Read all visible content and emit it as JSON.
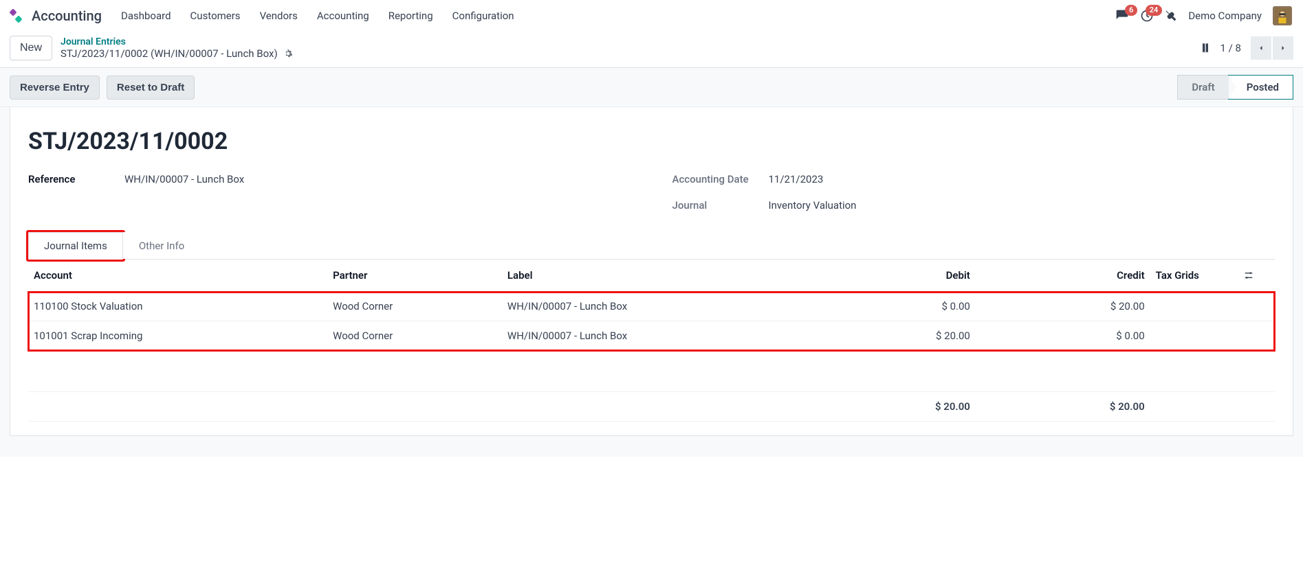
{
  "app_name": "Accounting",
  "nav": [
    "Dashboard",
    "Customers",
    "Vendors",
    "Accounting",
    "Reporting",
    "Configuration"
  ],
  "badges": {
    "messages": "6",
    "activities": "24"
  },
  "company": "Demo Company",
  "new_button": "New",
  "breadcrumb": {
    "parent": "Journal Entries",
    "current": "STJ/2023/11/0002 (WH/IN/00007 - Lunch Box)"
  },
  "pager": "1 / 8",
  "actions": {
    "reverse": "Reverse Entry",
    "reset": "Reset to Draft"
  },
  "status": {
    "draft": "Draft",
    "posted": "Posted"
  },
  "record": {
    "title": "STJ/2023/11/0002",
    "reference_label": "Reference",
    "reference_value": "WH/IN/00007 - Lunch Box",
    "date_label": "Accounting Date",
    "date_value": "11/21/2023",
    "journal_label": "Journal",
    "journal_value": "Inventory Valuation"
  },
  "tabs": {
    "journal_items": "Journal Items",
    "other_info": "Other Info"
  },
  "columns": {
    "account": "Account",
    "partner": "Partner",
    "label": "Label",
    "debit": "Debit",
    "credit": "Credit",
    "tax_grids": "Tax Grids"
  },
  "lines": [
    {
      "account": "110100 Stock Valuation",
      "partner": "Wood Corner",
      "label": "WH/IN/00007 - Lunch Box",
      "debit": "$ 0.00",
      "credit": "$ 20.00"
    },
    {
      "account": "101001 Scrap Incoming",
      "partner": "Wood Corner",
      "label": "WH/IN/00007 - Lunch Box",
      "debit": "$ 20.00",
      "credit": "$ 0.00"
    }
  ],
  "totals": {
    "debit": "$ 20.00",
    "credit": "$ 20.00"
  }
}
